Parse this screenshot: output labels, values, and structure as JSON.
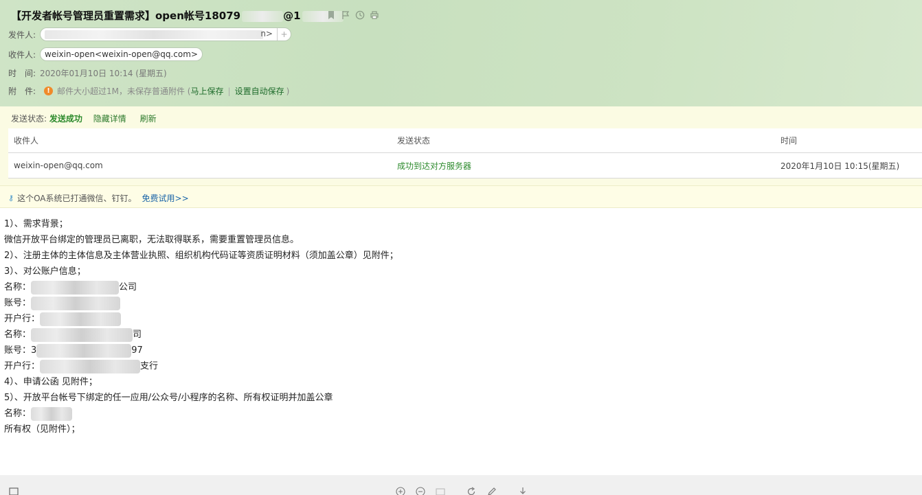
{
  "header": {
    "subject": "【开发者帐号管理员重置需求】open帐号18079",
    "subject_tail": "@1",
    "from_label": "发件人:",
    "from_value_tail": "n>",
    "to_label": "收件人:",
    "to_value": "weixin-open<weixin-open@qq.com>",
    "time_label": "时　间:",
    "time_value": "2020年01月10日 10:14 (星期五)",
    "attach_label": "附　件:",
    "attach_warn": "邮件大小超过1M，未保存普通附件 (",
    "attach_save": "马上保存",
    "attach_sep": "|",
    "attach_auto": "设置自动保存",
    "attach_close": ")"
  },
  "send_status": {
    "label": "发送状态:",
    "state": "发送成功",
    "hide_link": "隐藏详情",
    "refresh_link": "刷新",
    "columns": [
      "收件人",
      "发送状态",
      "时间"
    ],
    "rows": [
      [
        "weixin-open@qq.com",
        "成功到达对方服务器",
        "2020年1月10日 10:15(星期五)"
      ]
    ]
  },
  "ad": {
    "text": "这个OA系统已打通微信、钉钉。",
    "link": "免费试用>>"
  },
  "body_lines": [
    "1）、需求背景；",
    "微信开放平台绑定的管理员已离职，无法取得联系，需要重置管理员信息。",
    "2）、注册主体的主体信息及主体营业执照、组织机构代码证等资质证明材料（须加盖公章）见附件；",
    "3）、对公账户信息；",
    "名称：",
    "公司",
    "账号：",
    "开户行：",
    "名称：",
    "司",
    "账号：3",
    "97",
    "开户行：",
    "支行",
    "4）、申请公函  见附件；",
    "5）、开放平台帐号下绑定的任一应用/公众号/小程序的名称、所有权证明并加盖公章",
    " 名称：",
    "所有权（见附件）；"
  ],
  "icons": {
    "subject_actions": [
      "bookmark-icon",
      "flag-icon",
      "clock-icon",
      "print-icon"
    ],
    "toolbar": [
      "window-icon",
      "zoom-in-icon",
      "zoom-out-icon",
      "actual-size-icon",
      "rotate-icon",
      "edit-icon",
      "download-icon"
    ]
  },
  "colors": {
    "header_bg": "#cfe4c6",
    "status_bg": "#fbfbe3",
    "success": "#2c8a2c",
    "link_blue": "#1a64a8",
    "warn": "#f08a2a"
  }
}
